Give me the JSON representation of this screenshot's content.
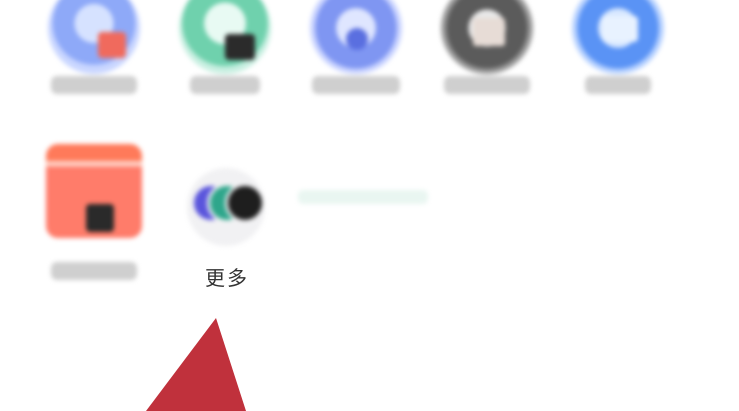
{
  "more": {
    "label": "更多"
  },
  "colors": {
    "arrow": "#c0313c",
    "more_icon_bg": "#f1f1f3",
    "dot_purple": "#5a55dc",
    "dot_green": "#2ea68b",
    "dot_black": "#1e1e1e"
  }
}
